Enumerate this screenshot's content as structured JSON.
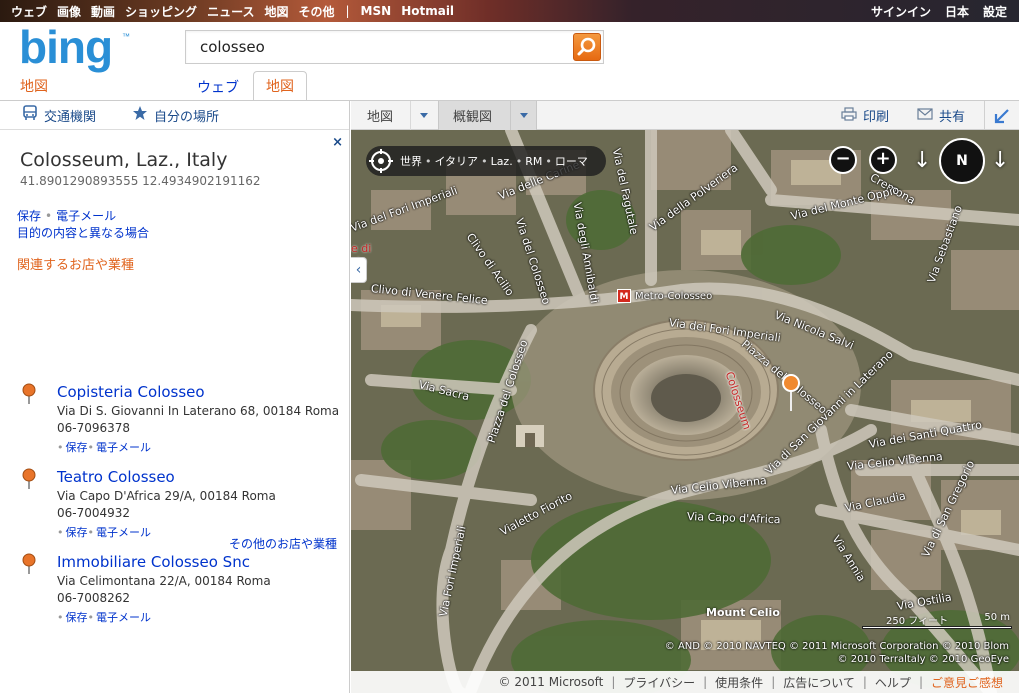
{
  "topnav": {
    "left": [
      "ウェブ",
      "画像",
      "動画",
      "ショッピング",
      "ニュース",
      "地図",
      "その他",
      "|",
      "MSN",
      "Hotmail"
    ],
    "right": [
      "サインイン",
      "日本",
      "設定"
    ]
  },
  "header": {
    "product_label": "地図",
    "search_value": "colosseo",
    "tabs": [
      {
        "label": "ウェブ",
        "active": false
      },
      {
        "label": "地図",
        "active": true
      }
    ]
  },
  "left_panel": {
    "toolbar": {
      "transit": "交通機関",
      "my_places": "自分の場所"
    },
    "close": "×",
    "place": {
      "title": "Colosseum, Laz., Italy",
      "coords": "41.8901290893555 12.4934902191162",
      "save": "保存",
      "email": "電子メール",
      "report": "目的の内容と異なる場合"
    },
    "nearby_heading": "関連するお店や業種",
    "businesses": [
      {
        "name": "Copisteria Colosseo",
        "address": "Via Di S. Giovanni In Laterano 68, 00184 Roma",
        "phone": "06-7096378",
        "save": "保存",
        "email": "電子メール"
      },
      {
        "name": "Teatro Colosseo",
        "address": "Via Capo D'Africa 29/A, 00184 Roma",
        "phone": "06-7004932",
        "save": "保存",
        "email": "電子メール"
      },
      {
        "name": "Immobiliare Colosseo Snc",
        "address": "Via Celimontana 22/A, 00184 Roma",
        "phone": "06-7008262",
        "save": "保存",
        "email": "電子メール"
      }
    ],
    "more_link": "その他のお店や業種"
  },
  "map_toolbar": {
    "road": "地図",
    "aerial": "概観図",
    "print": "印刷",
    "share": "共有"
  },
  "map": {
    "breadcrumb": [
      "世界",
      "イタリア",
      "Laz.",
      "RM",
      "ローマ"
    ],
    "zoom_out": "−",
    "zoom_in": "+",
    "compass": "N",
    "metro": {
      "icon": "M",
      "label": "Metro-Colosseo"
    },
    "poi_label": "Colosseum",
    "partial_label": "e di\nzio",
    "poi_name": "Mount Celio",
    "scale": {
      "feet": "250 フィート",
      "meters": "50 m"
    },
    "copyright": [
      "© AND  © 2010 NAVTEQ  © 2011 Microsoft Corporation  © 2010 Blom",
      "© 2010 Terraltaly  © 2010 GeoEye"
    ],
    "road_labels": [
      "Via Fori Imperiali",
      "Via delle Carine",
      "Via del Fagutale",
      "Via della Polveriera",
      "Cremona",
      "Via del Monte Oppio",
      "Via del Fori Imperiali",
      "Clivo di Acilio",
      "Via del Colosseo",
      "Via degli Annibaldi",
      "Clivo di Venere Felice",
      "Via dei Fori Imperiali",
      "Via Nicola Salvi",
      "Via Sebastiano",
      "Piazza del Colosseo",
      "Via Sacra",
      "Piazza del Colosseo",
      "Via di San Giovanni in Laterano",
      "Via dei Santi Quattro",
      "Via Celio Vibenna",
      "Via Celio Vibenna",
      "Vialetto Fiorito",
      "Via Capo d'Africa",
      "Via Claudia",
      "Via Annia",
      "Via Ostilia",
      "Via di San Gregorio"
    ]
  },
  "footer": {
    "items": [
      "© 2011 Microsoft",
      "プライバシー",
      "使用条件",
      "広告について",
      "ヘルプ"
    ],
    "feedback": "ご意見ご感想"
  }
}
